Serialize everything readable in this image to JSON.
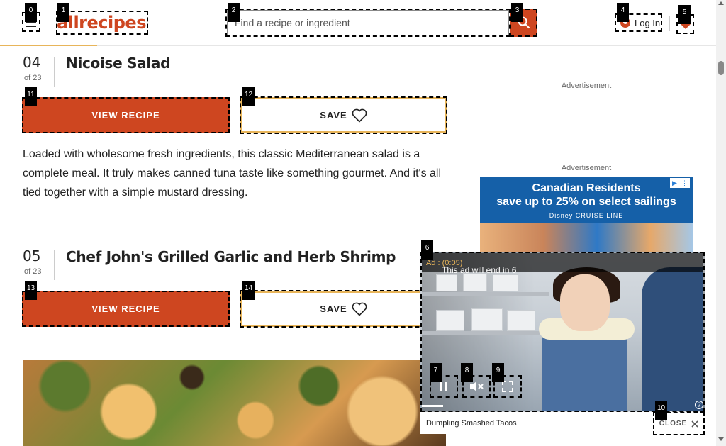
{
  "header": {
    "logo": "allrecipes",
    "search_placeholder": "Find a recipe or ingredient",
    "login_label": "Log In"
  },
  "items": [
    {
      "number": "04",
      "of": "of 23",
      "title": "Nicoise Salad",
      "view_label": "VIEW RECIPE",
      "save_label": "SAVE",
      "description": "Loaded with wholesome fresh ingredients, this classic Mediterranean salad is a complete meal. It truly makes canned tuna taste like something gourmet. And it's all tied together with a simple mustard dressing."
    },
    {
      "number": "05",
      "of": "of 23",
      "title": "Chef John's Grilled Garlic and Herb Shrimp",
      "view_label": "VIEW RECIPE",
      "save_label": "SAVE"
    }
  ],
  "ads": {
    "label": "Advertisement",
    "banner": {
      "line1": "Canadian Residents",
      "line2": "save up to 25% on select sailings",
      "line3": "Disney CRUISE LINE"
    }
  },
  "video_ad": {
    "ad_counter": "Ad : (0:05)",
    "ends_text": "This ad will end in 6",
    "caption": "Dumpling Smashed Tacos",
    "close_label": "CLOSE"
  },
  "badges": [
    "0",
    "1",
    "2",
    "3",
    "4",
    "5",
    "6",
    "7",
    "8",
    "9",
    "10",
    "11",
    "12",
    "13",
    "14"
  ],
  "colors": {
    "brand": "#ce4620",
    "accent": "#e8b55a"
  }
}
